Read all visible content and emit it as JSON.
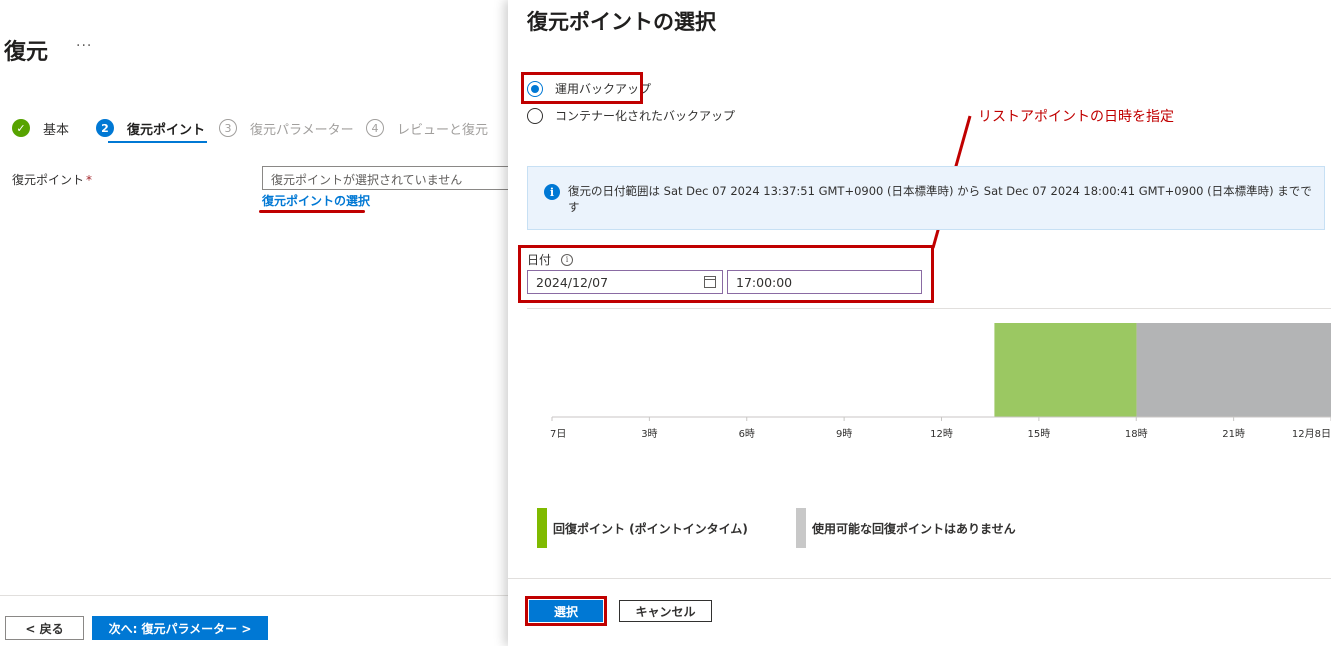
{
  "page": {
    "title": "復元",
    "more": "···"
  },
  "steps": [
    {
      "number": "✓",
      "label": "基本",
      "state": "done"
    },
    {
      "number": "2",
      "label": "復元ポイント",
      "state": "current"
    },
    {
      "number": "3",
      "label": "復元パラメーター",
      "state": "todo"
    },
    {
      "number": "4",
      "label": "レビューと復元",
      "state": "todo"
    }
  ],
  "form": {
    "restore_point_label": "復元ポイント",
    "required_mark": "*",
    "restore_point_value": "復元ポイントが選択されていません",
    "select_link": "復元ポイントの選択"
  },
  "footer": {
    "back_label": "< 戻る",
    "next_label": "次へ: 復元パラメーター >"
  },
  "blade": {
    "title": "復元ポイントの選択",
    "radio_options": [
      {
        "label": "運用バックアップ",
        "checked": true
      },
      {
        "label": "コンテナー化されたバックアップ",
        "checked": false
      }
    ],
    "annotation": "リストアポイントの日時を指定",
    "info_text": "復元の日付範囲は Sat Dec 07 2024 13:37:51 GMT+0900 (日本標準時) から Sat Dec 07 2024 18:00:41 GMT+0900 (日本標準時) までです",
    "date_label": "日付",
    "date_value": "2024/12/07",
    "time_value": "17:00:00",
    "select_label": "選択",
    "cancel_label": "キャンセル"
  },
  "chart_data": {
    "type": "bar",
    "x_axis_ticks": [
      "7日",
      "3時",
      "6時",
      "9時",
      "12時",
      "15時",
      "18時",
      "21時",
      "12月8日"
    ],
    "x_axis_hours": [
      0,
      3,
      6,
      9,
      12,
      15,
      18,
      21,
      24
    ],
    "xlim": [
      0,
      24
    ],
    "series": [
      {
        "name": "回復ポイント (ポイントインタイム)",
        "start_hour": 13.63,
        "end_hour": 18.01,
        "color": "#9bc862"
      },
      {
        "name": "使用可能な回復ポイントはありません",
        "start_hour": 18.01,
        "end_hour": 24,
        "color": "#b3b4b5"
      }
    ],
    "legend": [
      {
        "label": "回復ポイント (ポイントインタイム)",
        "color": "#7fba00"
      },
      {
        "label": "使用可能な回復ポイントはありません",
        "color": "#c8c8c8"
      }
    ],
    "legend_position": "bottom"
  }
}
